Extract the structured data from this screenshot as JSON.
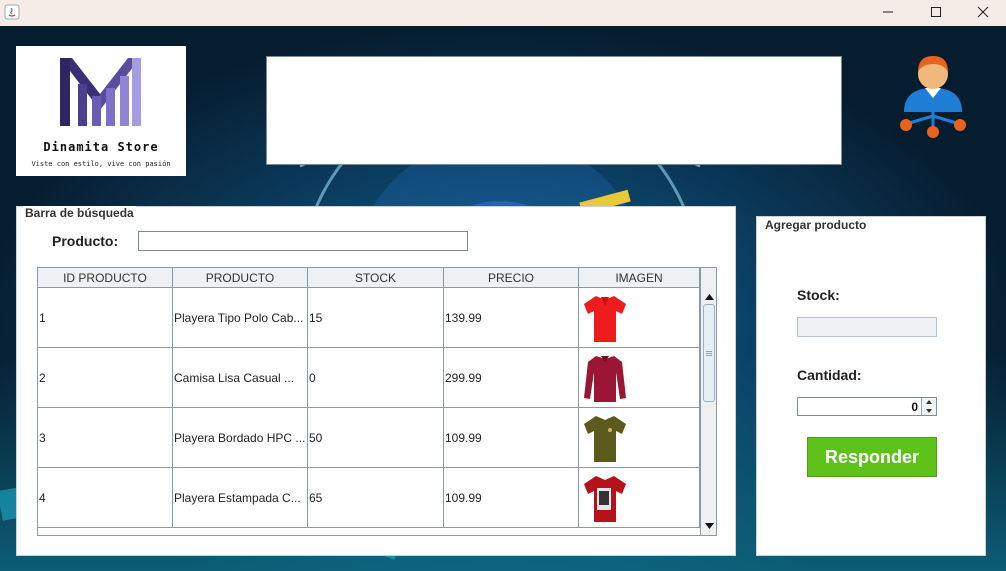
{
  "window": {
    "minimize_glyph": "—",
    "maximize_glyph": "☐",
    "close_glyph": "✕"
  },
  "logo": {
    "title": "Dinamita Store",
    "tagline": "Viste con estilo, vive con pasión"
  },
  "search_panel": {
    "legend": "Barra de búsqueda",
    "product_label": "Producto:",
    "product_value": ""
  },
  "table": {
    "columns": [
      "ID PRODUCTO",
      "PRODUCTO",
      "STOCK",
      "PRECIO",
      "IMAGEN"
    ],
    "rows": [
      {
        "id": "1",
        "product": "Playera Tipo Polo Cab...",
        "stock": "15",
        "price": "139.99",
        "image_icon": "red-polo-shirt-icon"
      },
      {
        "id": "2",
        "product": "Camisa Lisa Casual ...",
        "stock": "0",
        "price": "299.99",
        "image_icon": "maroon-long-sleeve-shirt-icon"
      },
      {
        "id": "3",
        "product": "Playera Bordado HPC ...",
        "stock": "50",
        "price": "109.99",
        "image_icon": "olive-tshirt-icon"
      },
      {
        "id": "4",
        "product": "Playera Estampada C...",
        "stock": "65",
        "price": "109.99",
        "image_icon": "red-printed-tshirt-icon"
      }
    ]
  },
  "add_panel": {
    "legend": "Agregar producto",
    "stock_label": "Stock:",
    "stock_value": "",
    "quantity_label": "Cantidad:",
    "quantity_value": "0",
    "respond_button": "Responder"
  },
  "colors": {
    "respond_button": "#5fc21a",
    "logo_purple": "#3c2f7a",
    "user_icon_blue": "#1f7fd6",
    "user_icon_orange": "#e8641e"
  }
}
